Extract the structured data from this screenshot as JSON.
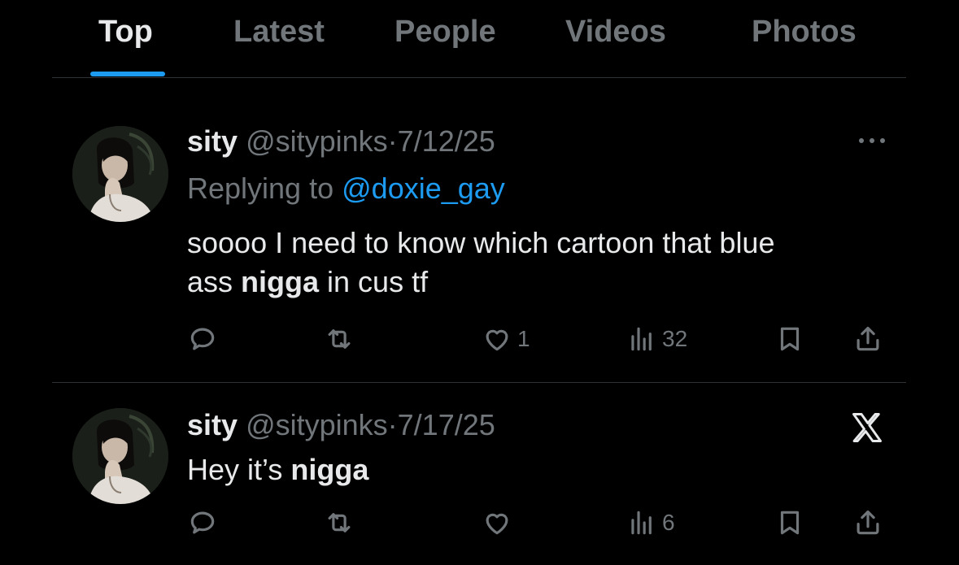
{
  "tabs": [
    {
      "label": "Top",
      "active": true
    },
    {
      "label": "Latest",
      "active": false
    },
    {
      "label": "People",
      "active": false
    },
    {
      "label": "Videos",
      "active": false
    },
    {
      "label": "Photos",
      "active": false
    }
  ],
  "accent_color": "#1d9bf0",
  "tweets": [
    {
      "name": "sity",
      "handle": "@sitypinks",
      "separator": "·",
      "date": "7/12/25",
      "reply_prefix": "Replying to",
      "reply_to": "@doxie_gay",
      "text_line1": "soooo I need to know which cartoon that blue",
      "text_line2_pre": "ass ",
      "text_line2_bold": "nigga",
      "text_line2_post": " in cus tf",
      "likes": "1",
      "views": "32",
      "top_right_icon": "more-icon"
    },
    {
      "name": "sity",
      "handle": "@sitypinks",
      "separator": "·",
      "date": "7/17/25",
      "text_pre": "Hey it’s ",
      "text_bold": "nigga",
      "views": "6",
      "top_right_icon": "x-logo-icon"
    }
  ]
}
